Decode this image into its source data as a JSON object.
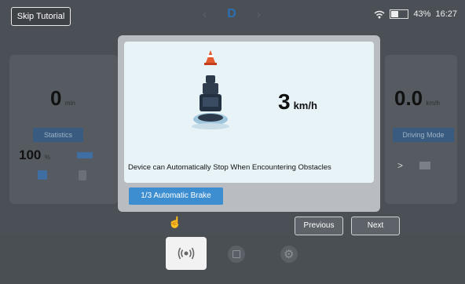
{
  "header": {
    "skip_label": "Skip Tutorial",
    "gear": "D",
    "battery_percent": "43%",
    "battery_level": 0.43,
    "time": "16:27"
  },
  "left_panel": {
    "time_value": "0",
    "time_unit": "min",
    "statistics_label": "Statistics",
    "percent_value": "100",
    "percent_unit": "%"
  },
  "right_panel": {
    "distance_value": "0.0",
    "distance_unit": "km/h",
    "driving_mode_label": "Driving Mode"
  },
  "dialog": {
    "speed_value": "3",
    "speed_unit": "km/h",
    "description": "Device can Automatically Stop When Encountering Obstacles",
    "step_label": "1/3 Automatic Brake"
  },
  "nav": {
    "previous_label": "Previous",
    "next_label": "Next"
  },
  "colors": {
    "accent": "#3d8ed1",
    "card_bg": "#e8f3f8",
    "dialog_bg": "#b9bcc0"
  }
}
